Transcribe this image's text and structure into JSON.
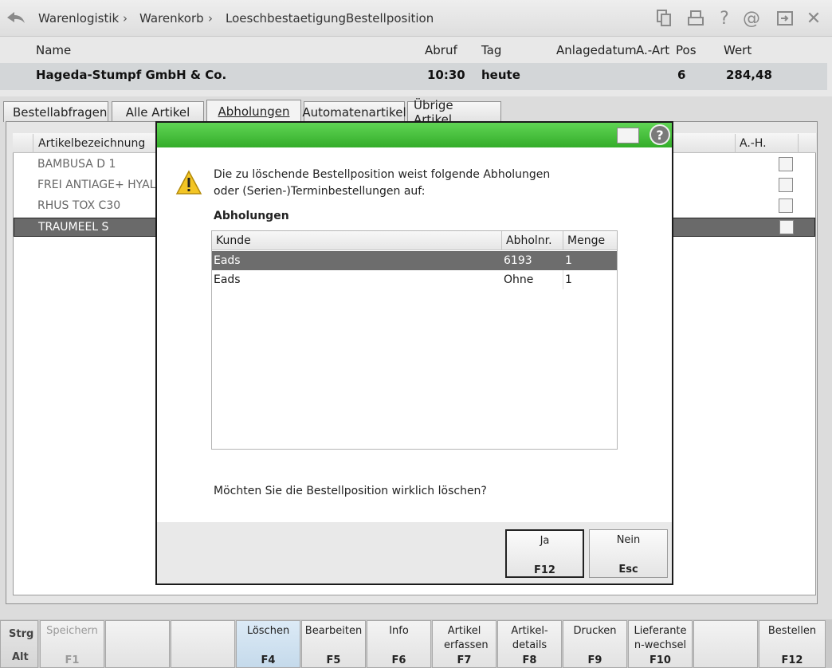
{
  "breadcrumb": [
    "Warenlogistik",
    "Warenkorb",
    "LoeschbestaetigungBestellposition"
  ],
  "breadcrumb_sep": "›",
  "toolbar_icons": [
    "copy-icon",
    "print-icon",
    "help-icon",
    "at-icon",
    "window-icon",
    "close-icon"
  ],
  "toolbar_glyphs": {
    "help": "?",
    "at": "@",
    "close": "✕"
  },
  "header": {
    "labels": {
      "name": "Name",
      "abruf": "Abruf",
      "tag": "Tag",
      "anlagedatum": "Anlagedatum",
      "aart": "A.-Art",
      "pos": "Pos",
      "wert": "Wert"
    },
    "values": {
      "name": "Hageda-Stumpf GmbH & Co.",
      "abruf": "10:30",
      "tag": "heute",
      "anlagedatum": "",
      "aart": "",
      "pos": "6",
      "wert": "284,48"
    }
  },
  "tabs": [
    {
      "label": "Bestellabfragen"
    },
    {
      "label": "Alle Artikel"
    },
    {
      "label": "Abholungen",
      "active": true
    },
    {
      "label": "Automatenartikel"
    },
    {
      "label": "Übrige Artikel"
    }
  ],
  "grid": {
    "headers": {
      "artikel": "Artikelbezeichnung",
      "ah": "A.-H."
    },
    "rows": [
      {
        "name": "BAMBUSA D 1"
      },
      {
        "name": "FREI ANTIAGE+ HYALU"
      },
      {
        "name": "RHUS TOX C30"
      },
      {
        "name": "TRAUMEEL S",
        "selected": true
      }
    ]
  },
  "dialog": {
    "message_line1": "Die zu löschende Bestellposition weist folgende Abholungen",
    "message_line2": "oder (Serien-)Terminbestellungen auf:",
    "section_title": "Abholungen",
    "table": {
      "headers": {
        "kunde": "Kunde",
        "abholnr": "Abholnr.",
        "menge": "Menge"
      },
      "rows": [
        {
          "kunde": "Eads",
          "abholnr": "6193",
          "menge": "1",
          "selected": true
        },
        {
          "kunde": "Eads",
          "abholnr": "Ohne",
          "menge": "1"
        }
      ]
    },
    "question": "Möchten Sie die Bestellposition wirklich löschen?",
    "buttons": {
      "yes": {
        "label": "Ja",
        "key": "F12"
      },
      "no": {
        "label": "Nein",
        "key": "Esc"
      }
    },
    "help_glyph": "?",
    "title_color": "#3cb832"
  },
  "modifiers": {
    "strg": "Strg",
    "alt": "Alt"
  },
  "fkeys": [
    {
      "label": "Speichern",
      "key": "F1",
      "disabled": true
    },
    {
      "label": "",
      "key": ""
    },
    {
      "label": "",
      "key": ""
    },
    {
      "label": "Löschen",
      "key": "F4",
      "highlight": true
    },
    {
      "label": "Bearbeiten",
      "key": "F5"
    },
    {
      "label": "Info",
      "key": "F6"
    },
    {
      "label": "Artikel erfassen",
      "key": "F7"
    },
    {
      "label": "Artikel-details",
      "key": "F8"
    },
    {
      "label": "Drucken",
      "key": "F9"
    },
    {
      "label": "Lieferanten-wechsel",
      "key": "F10"
    },
    {
      "label": "",
      "key": ""
    },
    {
      "label": "Bestellen",
      "key": "F12"
    }
  ]
}
